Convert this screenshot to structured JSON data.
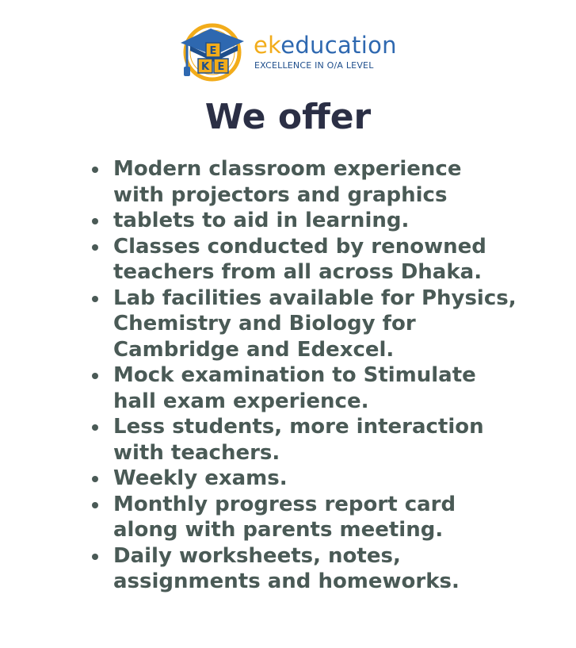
{
  "logo": {
    "brand_prefix": "ek",
    "brand_suffix": "education",
    "tagline": "EXCELLENCE IN O/A LEVEL",
    "colors": {
      "gold": "#f2ac1a",
      "blue": "#2e68b0",
      "navy": "#1f4f8c"
    },
    "icon": "graduation-cap-ke-seal-icon"
  },
  "heading": "We offer",
  "offers": [
    [
      "Modern classroom experience",
      "with projectors and graphics"
    ],
    [
      " tablets to aid in learning."
    ],
    [
      "Classes conducted by renowned",
      "teachers from all across Dhaka."
    ],
    [
      "Lab facilities available for Physics,",
      "Chemistry and Biology for",
      "Cambridge and Edexcel."
    ],
    [
      "Mock examination to Stimulate",
      "hall exam experience."
    ],
    [
      "Less students, more interaction",
      "with teachers."
    ],
    [
      "Weekly exams."
    ],
    [
      "Monthly progress report card",
      "along with parents meeting."
    ],
    [
      "Daily worksheets, notes,",
      "assignments and homeworks."
    ]
  ],
  "colors": {
    "heading": "#2b2f45",
    "body_text": "#4a5a56"
  }
}
